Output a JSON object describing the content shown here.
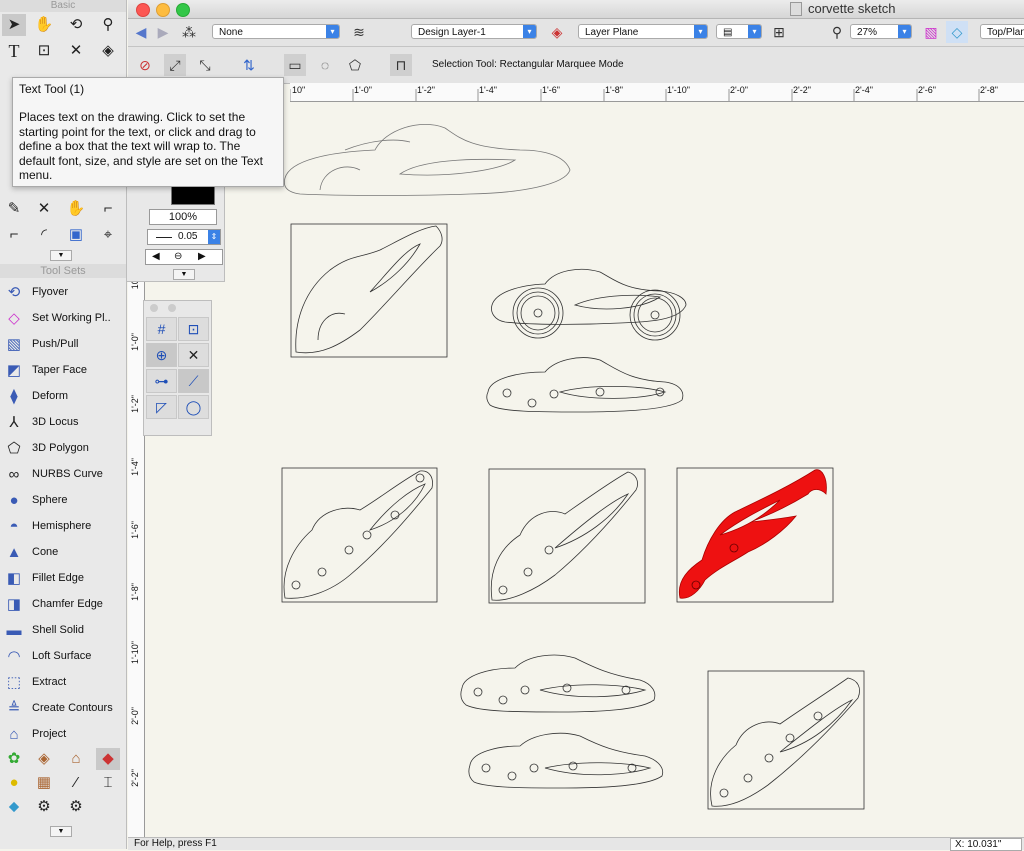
{
  "window": {
    "title": "corvette sketch"
  },
  "toolbar": {
    "class_select": "None",
    "layer_select": "Design Layer-1",
    "plane_select": "Layer Plane",
    "zoom_value": "27%",
    "view_select": "Top/Plan"
  },
  "mode_bar": {
    "status": "Selection Tool: Rectangular Marquee Mode"
  },
  "basic_palette": {
    "title": "Basic"
  },
  "tooltip": {
    "title": "Text Tool (1)",
    "body": "Places text on the drawing.  Click to set the starting point for the text, or click and drag to define a box that the text will wrap to.  The default font, size, and style are set on the Text menu."
  },
  "attributes": {
    "opacity": "100%",
    "line_weight": "0.05"
  },
  "toolsets": {
    "title": "Tool Sets",
    "items": [
      {
        "label": "Flyover",
        "icon": "flyover-icon"
      },
      {
        "label": "Set Working Pl..",
        "icon": "working-plane-icon"
      },
      {
        "label": "Push/Pull",
        "icon": "push-pull-icon"
      },
      {
        "label": "Taper Face",
        "icon": "taper-face-icon"
      },
      {
        "label": "Deform",
        "icon": "deform-icon"
      },
      {
        "label": "3D Locus",
        "icon": "locus-icon"
      },
      {
        "label": "3D Polygon",
        "icon": "polygon-icon"
      },
      {
        "label": "NURBS Curve",
        "icon": "nurbs-icon"
      },
      {
        "label": "Sphere",
        "icon": "sphere-icon"
      },
      {
        "label": "Hemisphere",
        "icon": "hemisphere-icon"
      },
      {
        "label": "Cone",
        "icon": "cone-icon"
      },
      {
        "label": "Fillet Edge",
        "icon": "fillet-icon"
      },
      {
        "label": "Chamfer Edge",
        "icon": "chamfer-icon"
      },
      {
        "label": "Shell Solid",
        "icon": "shell-icon"
      },
      {
        "label": "Loft Surface",
        "icon": "loft-icon"
      },
      {
        "label": "Extract",
        "icon": "extract-icon"
      },
      {
        "label": "Create Contours",
        "icon": "contours-icon"
      },
      {
        "label": "Project",
        "icon": "project-icon"
      }
    ]
  },
  "ruler_h": [
    "10\"",
    "1'-0\"",
    "1'-2\"",
    "1'-4\"",
    "1'-6\"",
    "1'-8\"",
    "1'-10\"",
    "2'-0\"",
    "2'-2\"",
    "2'-4\"",
    "2'-6\"",
    "2'-8\""
  ],
  "ruler_v": [
    "10\"",
    "1'-0\"",
    "1'-2\"",
    "1'-4\"",
    "1'-6\"",
    "1'-8\"",
    "1'-10\"",
    "2'-0\"",
    "2'-2\""
  ],
  "statusbar": {
    "help": "For Help, press F1",
    "coord": "X: 10.031\""
  },
  "colors": {
    "highlight_fill": "#ee1111",
    "canvas": "#f5f4ec"
  }
}
